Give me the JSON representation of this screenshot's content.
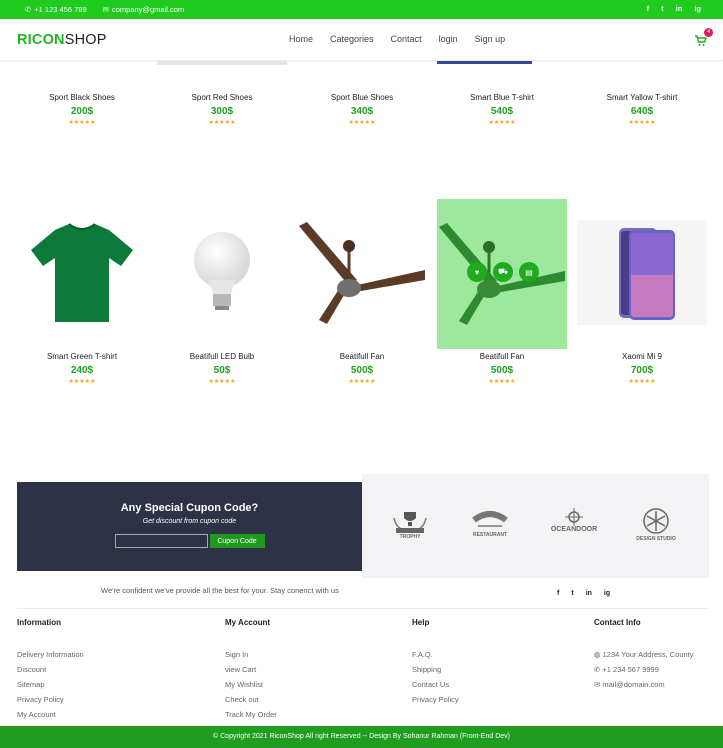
{
  "topbar": {
    "phone": "+1 123 456 789",
    "email": "company@gmail.com",
    "social": [
      "f",
      "t",
      "in",
      "ig"
    ]
  },
  "header": {
    "logo_green": "RICON",
    "logo_dark": "SHOP",
    "nav": [
      "Home",
      "Categories",
      "Contact",
      "login",
      "Sign up"
    ],
    "cart_count": "4"
  },
  "products_row1": [
    {
      "name": "Sport Black Shoes",
      "price": "200$",
      "stars": "★★★★★"
    },
    {
      "name": "Sport Red Shoes",
      "price": "300$",
      "stars": "★★★★★"
    },
    {
      "name": "Sport Blue Shoes",
      "price": "340$",
      "stars": "★★★★★"
    },
    {
      "name": "Smart Blue T-shirt",
      "price": "540$",
      "stars": "★★★★★"
    },
    {
      "name": "Smart Yallow T-shirt",
      "price": "640$",
      "stars": "★★★★★"
    }
  ],
  "products_row2": [
    {
      "name": "Smart Green T-shirt",
      "price": "240$",
      "stars": "★★★★★"
    },
    {
      "name": "Beatifull LED Bulb",
      "price": "50$",
      "stars": "★★★★★"
    },
    {
      "name": "Beatifull Fan",
      "price": "500$",
      "stars": "★★★★★"
    },
    {
      "name": "Beatifull Fan",
      "price": "500$",
      "stars": "★★★★★"
    },
    {
      "name": "Xaomi Mi 9",
      "price": "700$",
      "stars": "★★★★★"
    }
  ],
  "coupon": {
    "title": "Any Special Cupon Code?",
    "subtitle": "Get discount from cupon code",
    "input_value": "",
    "button": "Cupon Code"
  },
  "brands": [
    {
      "text": "TROPHY"
    },
    {
      "text": "RESTAURANT"
    },
    {
      "text": "OCEANDOOR"
    },
    {
      "text": "DESIGN STUDIO"
    }
  ],
  "tagline": "We're confident we've provide all the best for your. Stay conenct with us",
  "footer": {
    "information": {
      "title": "Information",
      "items": [
        "Delivery Information",
        "Discount",
        "Sitemap",
        "Privacy Policy",
        "My Account"
      ]
    },
    "account": {
      "title": "My Account",
      "items": [
        "Sign In",
        "view Cart",
        "My Wishlist",
        "Check out",
        "Track My Order"
      ]
    },
    "help": {
      "title": "Help",
      "items": [
        "F.A.Q.",
        "Shipping",
        "Contact Us",
        "Privacy Policy"
      ]
    },
    "contact": {
      "title": "Contact Info",
      "address": "1234 Your Address, County",
      "phone": "+1 234 567 9999",
      "email": "mail@domain.com"
    }
  },
  "copyright": "© Copyright 2021 RiconShop All right Reserved -- Design By Sohanur Rahman (Front-End Dev)",
  "colors": {
    "brand_green": "#1fcb1f",
    "price_green": "#1fa31f",
    "coupon_bg": "#2e3247",
    "star": "#f2a212"
  }
}
